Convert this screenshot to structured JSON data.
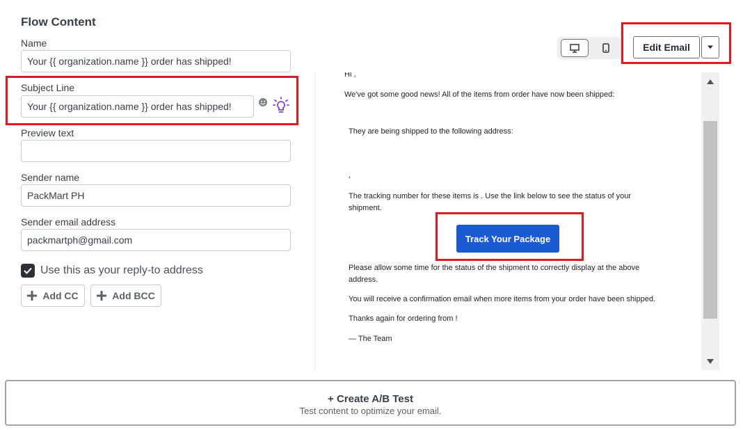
{
  "section_title": "Flow Content",
  "fields": {
    "name": {
      "label": "Name",
      "value": "Your {{ organization.name }} order has shipped!"
    },
    "subject": {
      "label": "Subject Line",
      "value": "Your {{ organization.name }} order has shipped!"
    },
    "preview_text": {
      "label": "Preview text",
      "value": ""
    },
    "sender_name": {
      "label": "Sender name",
      "value": "PackMart PH"
    },
    "sender_email": {
      "label": "Sender email address",
      "value": "packmartph@gmail.com"
    }
  },
  "reply_to": {
    "label": "Use this as your reply-to address",
    "checked": true
  },
  "cc_buttons": {
    "add_cc": "Add CC",
    "add_bcc": "Add BCC"
  },
  "toolbar": {
    "edit_email": "Edit Email"
  },
  "email_preview": {
    "greeting": "Hi ,",
    "intro": "We've got some good news! All of the items from order have now been shipped:",
    "address_line": "They are being shipped to the following address:",
    "comma": ",",
    "tracking_line1": "The tracking number for these items is . Use the link below to see the status of your",
    "tracking_line2": "shipment.",
    "track_button": "Track Your Package",
    "allow_line1": "Please allow some time for the status of the shipment to correctly display at the above",
    "allow_line2": "address.",
    "confirm_line": "You will receive a confirmation email when more items from your order have been shipped.",
    "thanks_line": "Thanks again for ordering from !",
    "signoff": "— The Team"
  },
  "ab_test": {
    "title": "+ Create A/B Test",
    "subtitle": "Test content to optimize your email."
  },
  "colors": {
    "highlight": "#e2171f",
    "primary_button": "#1a5bd4",
    "ai_icon": "#7b3fe4"
  }
}
